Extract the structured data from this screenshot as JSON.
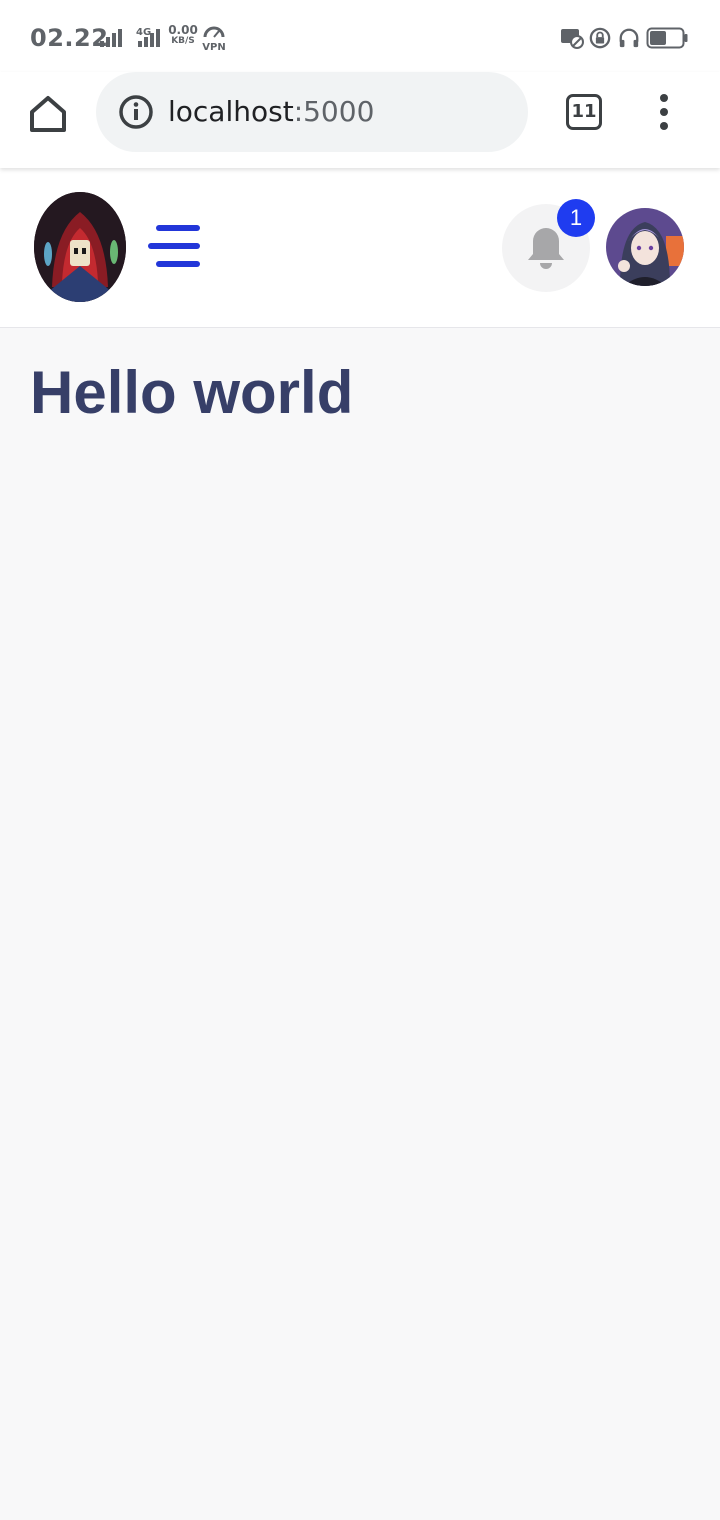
{
  "status_bar": {
    "time": "02.22",
    "network_type": "4G",
    "speed_value": "0.00",
    "speed_unit": "KB/S",
    "vpn_label": "VPN",
    "icons": [
      "signal-icon",
      "signal-icon",
      "cast-off-icon",
      "rotation-lock-icon",
      "headphones-icon",
      "battery-icon"
    ]
  },
  "browser": {
    "url_host": "localhost",
    "url_port": ":5000",
    "tab_count": "11",
    "icons": [
      "home-icon",
      "info-icon",
      "tabs-icon",
      "more-vert-icon"
    ]
  },
  "header": {
    "notification_count": "1",
    "icons": [
      "logo-image",
      "hamburger-icon",
      "bell-icon",
      "avatar-image"
    ],
    "accent_color": "#2236d9",
    "badge_color": "#1f3cf0"
  },
  "main": {
    "title": "Hello world",
    "title_color": "#373f68"
  }
}
